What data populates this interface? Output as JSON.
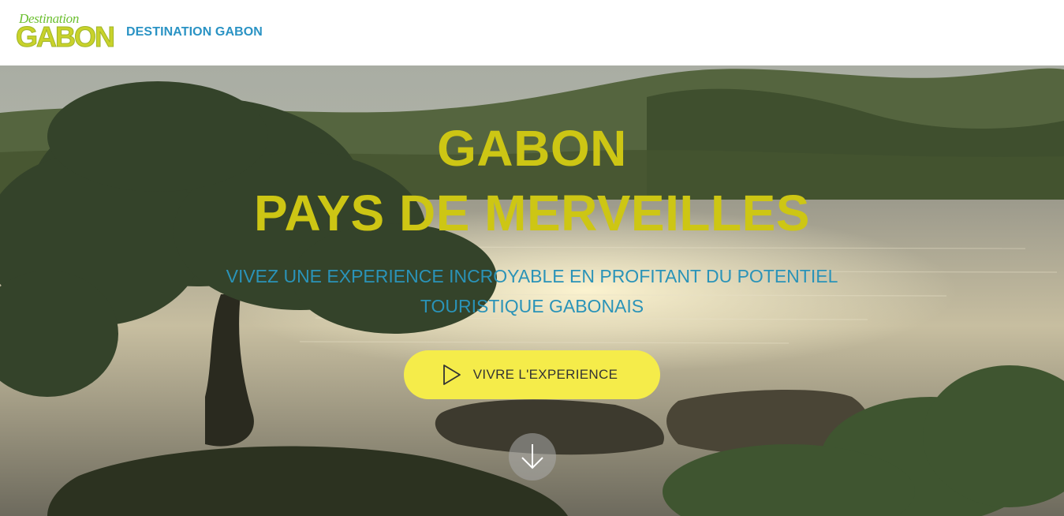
{
  "header": {
    "logo": {
      "small": "Destination",
      "big": "GABON"
    },
    "brand_link": "DESTINATION GABON"
  },
  "hero": {
    "title_line1": "GABON",
    "title_line2": "PAYS DE MERVEILLES",
    "subtitle_line1": "VIVEZ UNE EXPERIENCE INCROYABLE EN PROFITANT DU POTENTIEL",
    "subtitle_line2": "TOURISTIQUE GABONAIS",
    "cta_label": "VIVRE L'EXPERIENCE",
    "cta_icon": "play-icon",
    "scroll_icon": "arrow-down-icon"
  },
  "colors": {
    "title": "#cdc614",
    "subtitle": "#2a93b8",
    "brand_link": "#2a93c4",
    "cta_background": "#f5ec4a",
    "logo_green": "#6bbf2f",
    "logo_yellow": "#c9d22a"
  }
}
